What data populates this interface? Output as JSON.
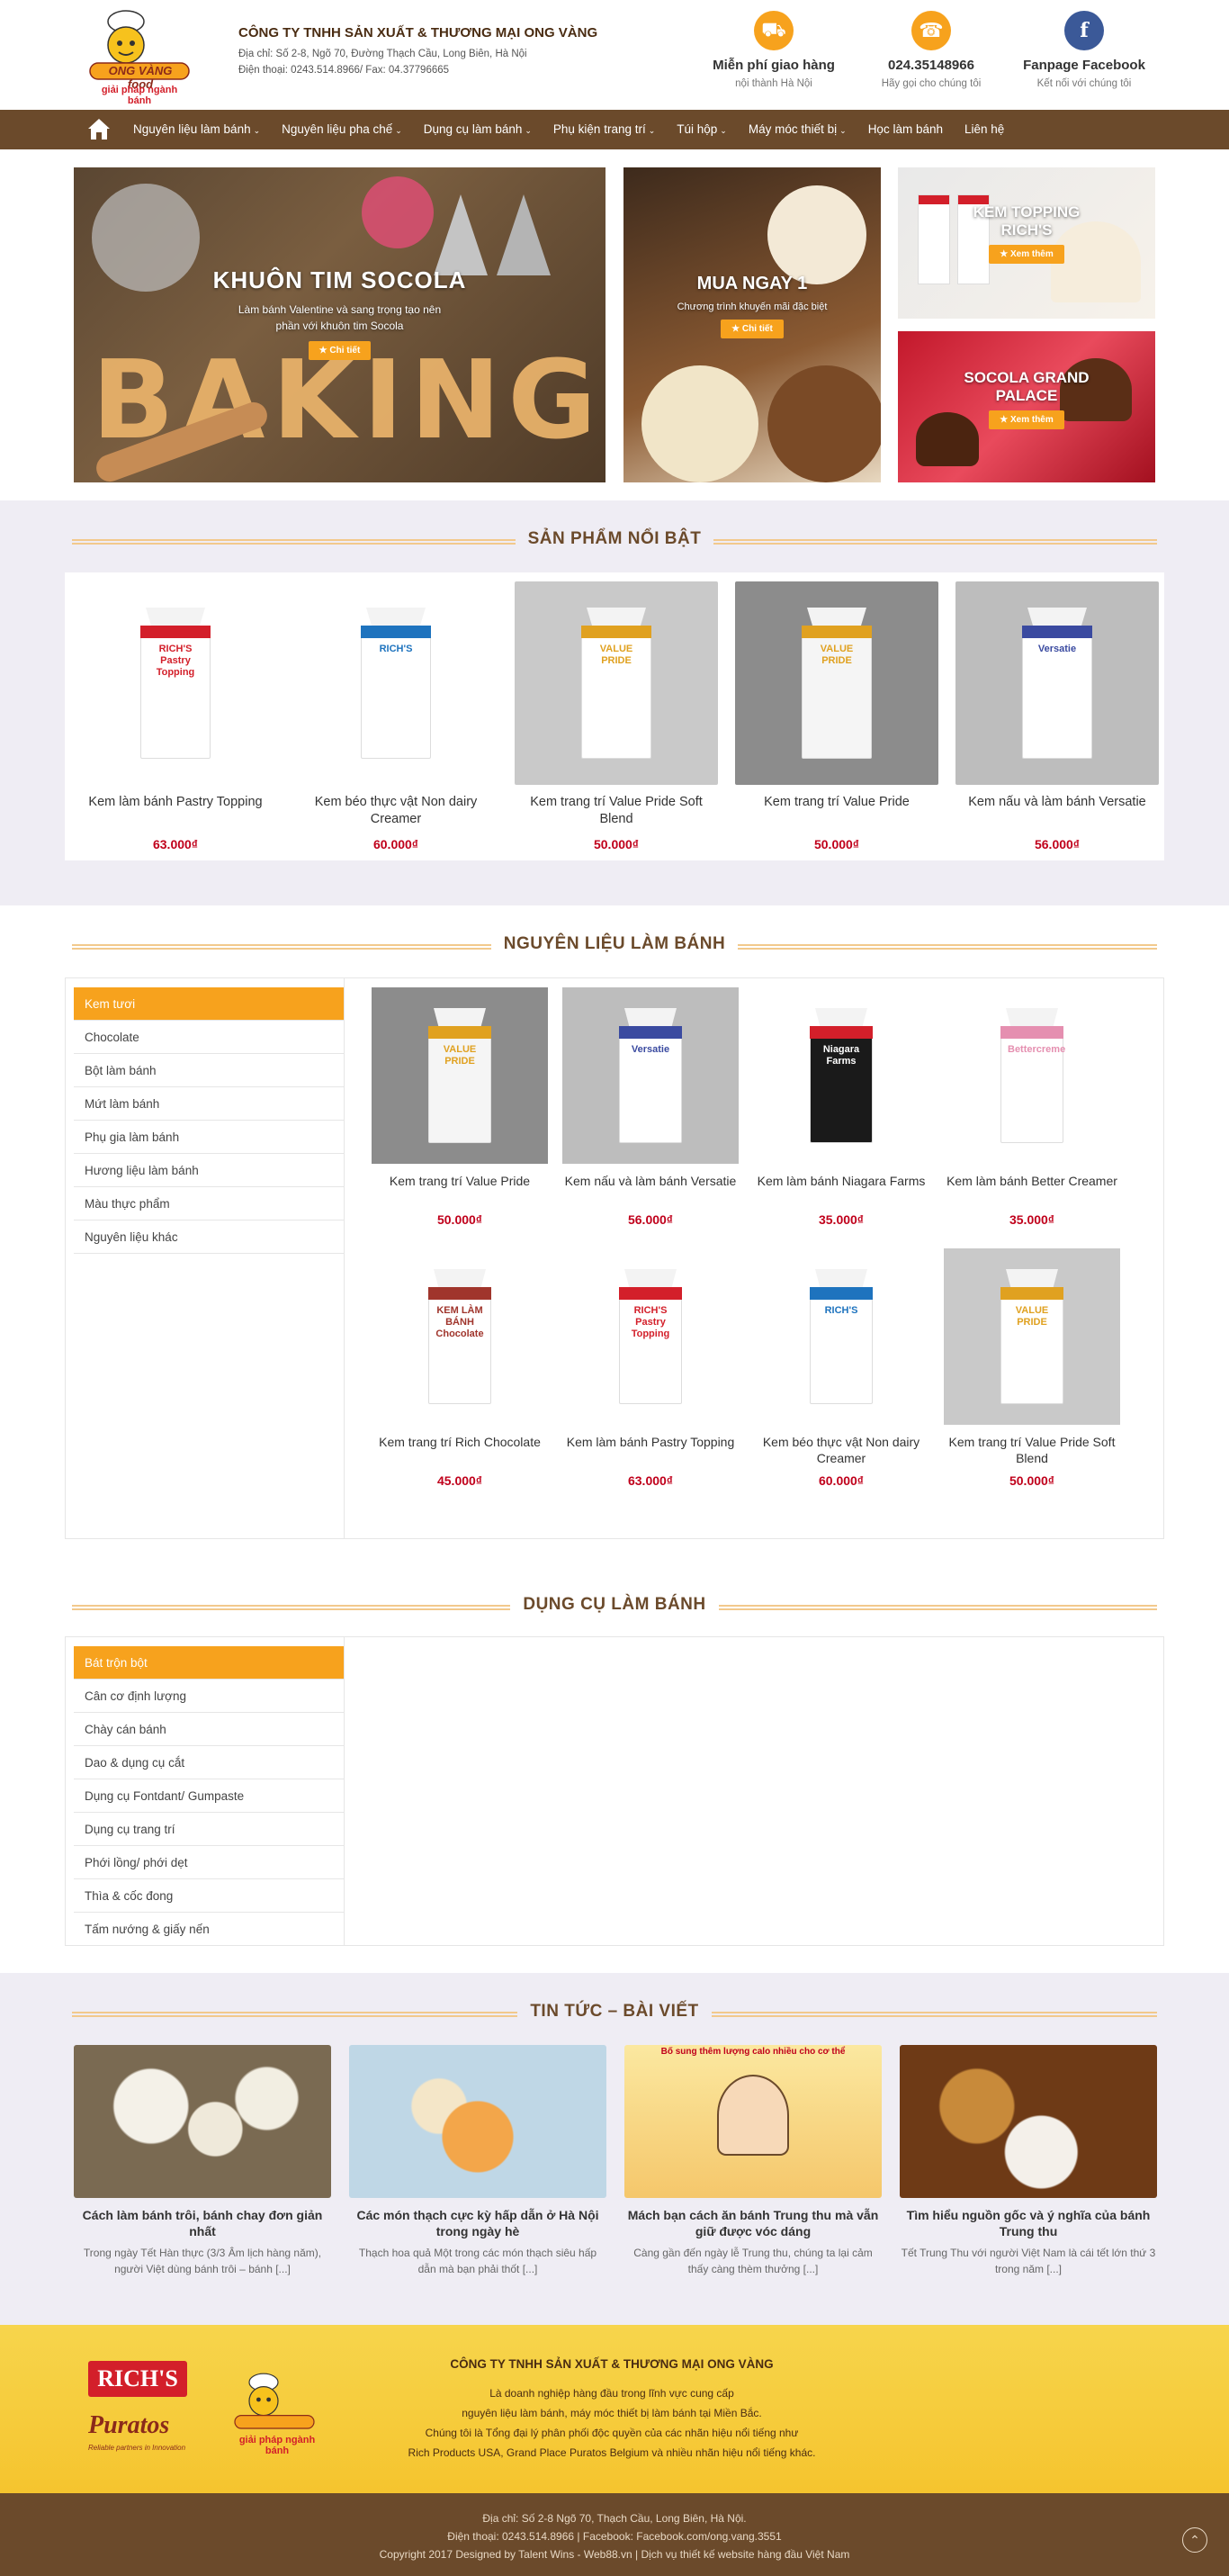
{
  "header": {
    "logo_text": "ONG VÀNG food",
    "logo_tagline": "giải pháp ngành bánh",
    "company_name": "CÔNG TY TNHH SẢN XUẤT & THƯƠNG MẠI ONG VÀNG",
    "address": "Địa chỉ: Số 2-8, Ngõ 70, Đường Thạch Cầu, Long Biên, Hà Nội",
    "phone": "Điện thoại: 0243.514.8966/ Fax: 04.37796665",
    "info": [
      {
        "icon": "truck-icon",
        "title": "Miễn phí giao hàng",
        "sub": "nội thành Hà Nội",
        "color": "#f7a21d"
      },
      {
        "icon": "phone-icon",
        "title": "024.35148966",
        "sub": "Hãy gọi cho chúng tôi",
        "color": "#f7a21d"
      },
      {
        "icon": "facebook-icon",
        "title": "Fanpage Facebook",
        "sub": "Kết nối với chúng tôi",
        "color": "#3b5998"
      }
    ]
  },
  "nav": {
    "items": [
      {
        "label": "Nguyên liệu làm bánh",
        "caret": true
      },
      {
        "label": "Nguyên liệu pha chế",
        "caret": true
      },
      {
        "label": "Dụng cụ làm bánh",
        "caret": true
      },
      {
        "label": "Phụ kiện trang trí",
        "caret": true
      },
      {
        "label": "Túi hộp",
        "caret": true
      },
      {
        "label": "Máy móc thiết bị",
        "caret": true
      },
      {
        "label": "Học làm bánh",
        "caret": false
      },
      {
        "label": "Liên hệ",
        "caret": false
      }
    ]
  },
  "banners": {
    "main": {
      "title": "KHUÔN TIM SOCOLA",
      "desc": "Làm bánh Valentine và sang trọng tạo nên phần với khuôn tim Socola",
      "button": "Chi tiết",
      "bg_word": "BAKING"
    },
    "middle": {
      "title": "MUA NGAY 1",
      "desc": "Chương trình khuyến mãi đặc biệt",
      "button": "Chi tiết"
    },
    "top_right": {
      "title": "KEM TOPPING RICH'S",
      "button": "Xem thêm"
    },
    "bottom_right": {
      "title": "SOCOLA GRAND PALACE",
      "button": "Xem thêm"
    }
  },
  "featured": {
    "title": "SẢN PHẨM NỔI BẬT",
    "products": [
      {
        "name": "Kem làm bánh Pastry Topping",
        "price": "63.000₫",
        "label": "RICH'S Pastry Topping",
        "color": "#ffffff",
        "accent": "#d31f2a",
        "bg": "#ffffff"
      },
      {
        "name": "Kem béo thực vật Non dairy Creamer",
        "price": "60.000₫",
        "label": "RICH'S",
        "color": "#ffffff",
        "accent": "#1e73be",
        "bg": "#ffffff"
      },
      {
        "name": "Kem trang trí Value Pride Soft Blend",
        "price": "50.000₫",
        "label": "VALUE PRIDE",
        "color": "#ffffff",
        "accent": "#e0a120",
        "bg": "#c9c9c9"
      },
      {
        "name": "Kem trang trí Value Pride",
        "price": "50.000₫",
        "label": "VALUE PRIDE",
        "color": "#f5f5f5",
        "accent": "#e0a120",
        "bg": "#8c8c8c"
      },
      {
        "name": "Kem nấu và làm bánh Versatie",
        "price": "56.000₫",
        "label": "Versatie",
        "color": "#ffffff",
        "accent": "#3a4aa0",
        "bg": "#bdbdbd"
      }
    ]
  },
  "ingredients": {
    "title": "NGUYÊN LIỆU LÀM BÁNH",
    "categories": [
      "Kem tươi",
      "Chocolate",
      "Bột làm bánh",
      "Mứt làm bánh",
      "Phụ gia làm bánh",
      "Hương liệu làm bánh",
      "Màu thực phẩm",
      "Nguyên liệu khác"
    ],
    "products": [
      {
        "name": "Kem trang trí Value Pride",
        "price": "50.000₫",
        "label": "VALUE PRIDE",
        "color": "#f5f5f5",
        "accent": "#e0a120",
        "bg": "#8c8c8c"
      },
      {
        "name": "Kem nấu và làm bánh Versatie",
        "price": "56.000₫",
        "label": "Versatie",
        "color": "#ffffff",
        "accent": "#3a4aa0",
        "bg": "#bdbdbd"
      },
      {
        "name": "Kem làm bánh Niagara Farms",
        "price": "35.000₫",
        "label": "Niagara Farms",
        "color": "#1a1a1a",
        "accent": "#d31f2a",
        "bg": "#ffffff"
      },
      {
        "name": "Kem làm bánh Better Creamer",
        "price": "35.000₫",
        "label": "Bettercreme",
        "color": "#ffffff",
        "accent": "#e58fb0",
        "bg": "#ffffff"
      },
      {
        "name": "Kem trang trí Rich Chocolate",
        "price": "45.000₫",
        "label": "KEM LÀM BÁNH Chocolate",
        "color": "#ffffff",
        "accent": "#a0352c",
        "bg": "#ffffff"
      },
      {
        "name": "Kem làm bánh Pastry Topping",
        "price": "63.000₫",
        "label": "RICH'S Pastry Topping",
        "color": "#ffffff",
        "accent": "#d31f2a",
        "bg": "#ffffff"
      },
      {
        "name": "Kem béo thực vật Non dairy Creamer",
        "price": "60.000₫",
        "label": "RICH'S",
        "color": "#ffffff",
        "accent": "#1e73be",
        "bg": "#ffffff"
      },
      {
        "name": "Kem trang trí Value Pride Soft Blend",
        "price": "50.000₫",
        "label": "VALUE PRIDE",
        "color": "#ffffff",
        "accent": "#e0a120",
        "bg": "#c9c9c9"
      }
    ]
  },
  "tools": {
    "title": "DỤNG CỤ LÀM BÁNH",
    "categories": [
      "Bát trộn bột",
      "Cân cơ định lượng",
      "Chày cán bánh",
      "Dao & dụng cụ cắt",
      "Dụng cụ Fontdant/ Gumpaste",
      "Dụng cụ trang trí",
      "Phới lồng/ phới dẹt",
      "Thìa & cốc đong",
      "Tấm nướng & giấy nến"
    ]
  },
  "news": {
    "title": "TIN TỨC – BÀI VIẾT",
    "items": [
      {
        "title": "Cách làm bánh trôi, bánh chay đơn giản nhất",
        "excerpt": "Trong ngày Tết Hàn thực (3/3 Âm lịch hàng năm), người Việt dùng bánh trôi – bánh [...]",
        "img_text": ""
      },
      {
        "title": "Các món thạch cực kỳ hấp dẫn ở Hà Nội trong ngày hè",
        "excerpt": "Thạch hoa quả Một trong các món thạch siêu hấp dẫn mà bạn phải thốt [...]",
        "img_text": ""
      },
      {
        "title": "Mách bạn cách ăn bánh Trung thu mà vẫn giữ được vóc dáng",
        "excerpt": "Càng gần đến ngày lễ Trung thu, chúng ta lại cảm thấy càng thèm thưởng [...]",
        "img_text": "Bố sung thêm lượng calo nhiều cho cơ thể"
      },
      {
        "title": "Tìm hiểu nguồn gốc và ý nghĩa của bánh Trung thu",
        "excerpt": "Tết Trung Thu với người Việt Nam là cái tết lớn thứ 3 trong năm [...]",
        "img_text": ""
      }
    ]
  },
  "footer": {
    "brand_1": "RICH'S",
    "brand_2": "Puratos",
    "brand_2_tag": "Reliable partners in Innovation",
    "company": "CÔNG TY TNHH SẢN XUẤT & THƯƠNG MẠI ONG VÀNG",
    "desc": [
      "Là doanh nghiệp hàng đầu trong lĩnh vực cung cấp",
      "nguyên liệu làm bánh, máy móc thiết bị làm bánh tại Miền Bắc.",
      "Chúng tôi là Tổng đại lý phân phối độc quyền của các nhãn hiệu nổi tiếng như",
      "Rich Products USA, Grand Place Puratos Belgium và nhiều nhãn hiệu nổi tiếng khác."
    ],
    "address": "Địa chỉ: Số 2-8 Ngõ 70, Thạch Cầu, Long Biên, Hà Nội.",
    "contact": "Điện thoại: 0243.514.8966 | Facebook: Facebook.com/ong.vang.3551",
    "copyright": "Copyright 2017 Designed by Talent Wins - Web88.vn | Dịch vụ thiết kế website hàng đầu Việt Nam"
  }
}
